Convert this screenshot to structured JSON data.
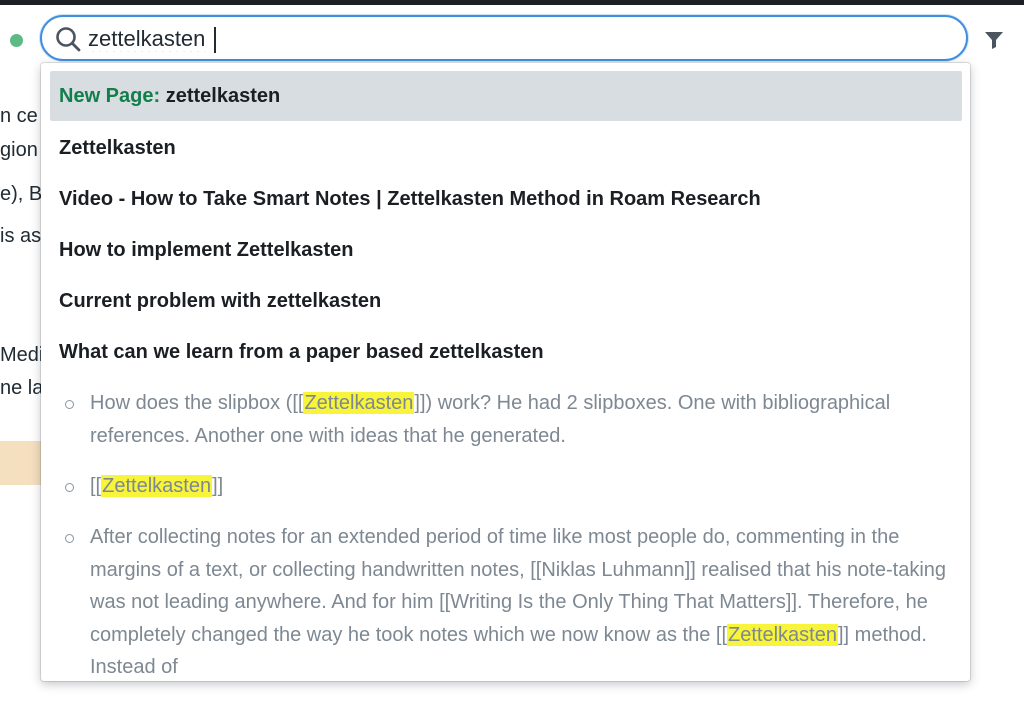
{
  "search": {
    "value": "zettelkasten"
  },
  "background_fragments": [
    "n ce",
    "gion",
    "e), B",
    "is as",
    "Medi",
    "ne la"
  ],
  "results": {
    "new_page": {
      "prefix": "New Page:",
      "title": "zettelkasten"
    },
    "pages": [
      "Zettelkasten",
      "Video - How to Take Smart Notes | Zettelkasten Method in Roam Research",
      "How to implement Zettelkasten",
      "Current problem with zettelkasten",
      "What can we learn from a paper based zettelkasten"
    ],
    "blocks": [
      {
        "before": "How does the slipbox ([[",
        "highlight": "Zettelkasten",
        "after": "]]) work? He had 2 slipboxes. One with bibliographical references. Another one with ideas that he generated."
      },
      {
        "before": "[[",
        "highlight": "Zettelkasten",
        "after": "]]"
      },
      {
        "before": "After collecting notes for an extended period of time like most people do, commenting in the margins of a text, or collecting handwritten notes, [[Niklas Luhmann]] realised that his note-taking was not leading anywhere. And for him [[Writing Is the Only Thing That Matters]]. Therefore, he completely changed the way he took notes which we now know as the [[",
        "highlight": "Zettelkasten",
        "after": "]] method. Instead of"
      }
    ]
  },
  "colors": {
    "accent": "#3f8ee0",
    "new_page": "#127e4a",
    "highlight": "#f7f43a",
    "status_dot": "#5cba83"
  },
  "icons": [
    "search-icon",
    "filter-icon",
    "status-dot"
  ]
}
